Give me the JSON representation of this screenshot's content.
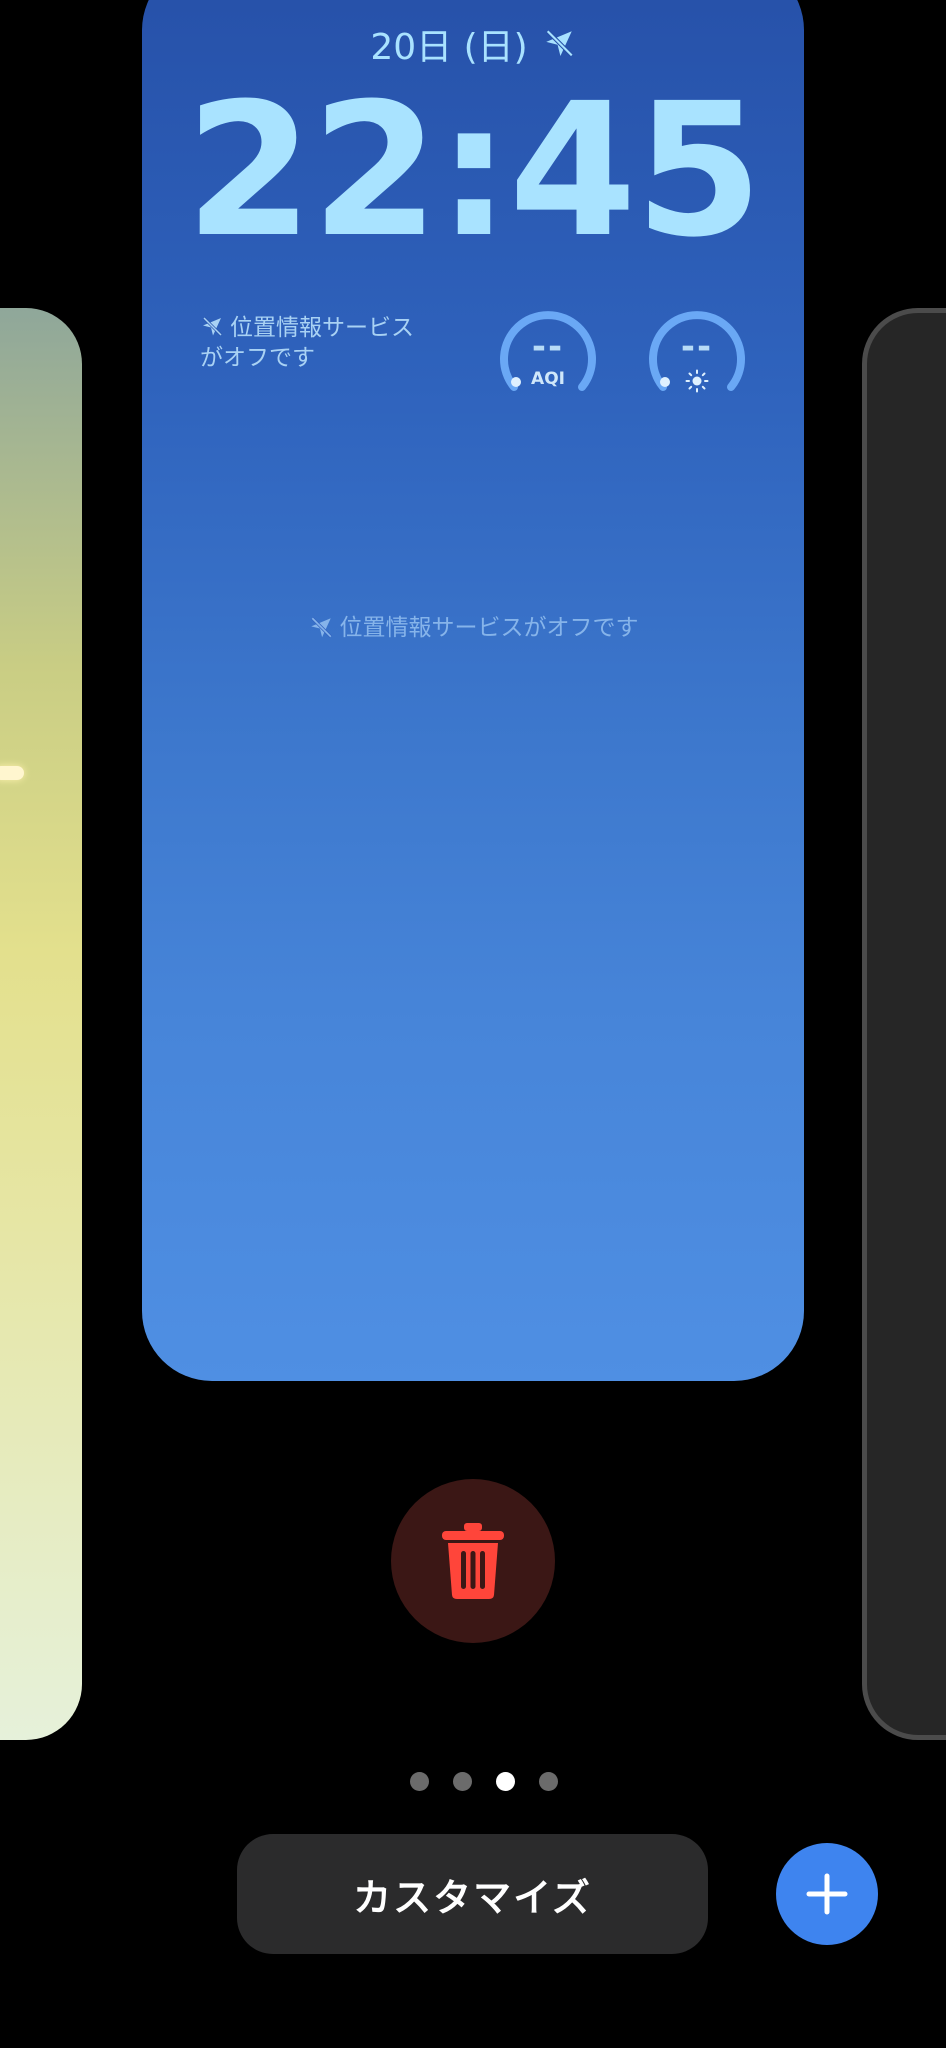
{
  "lockscreen": {
    "date": "20日 (日)",
    "time": "22:45",
    "location_widget_text_line1": "位置情報サービス",
    "location_widget_text_line2": "がオフです",
    "aqi_gauge": {
      "value": "--",
      "label": "AQI"
    },
    "uv_gauge": {
      "value": "--",
      "label": "sun-icon"
    },
    "center_message": "位置情報サービスがオフです"
  },
  "page_indicator": {
    "count": 4,
    "active_index": 2
  },
  "actions": {
    "customize_label": "カスタマイズ",
    "delete_icon": "trash-icon",
    "add_icon": "plus-icon"
  },
  "colors": {
    "accent": "#3e84ef",
    "delete_red": "#ff453a",
    "clock_text": "#a9e3ff"
  }
}
